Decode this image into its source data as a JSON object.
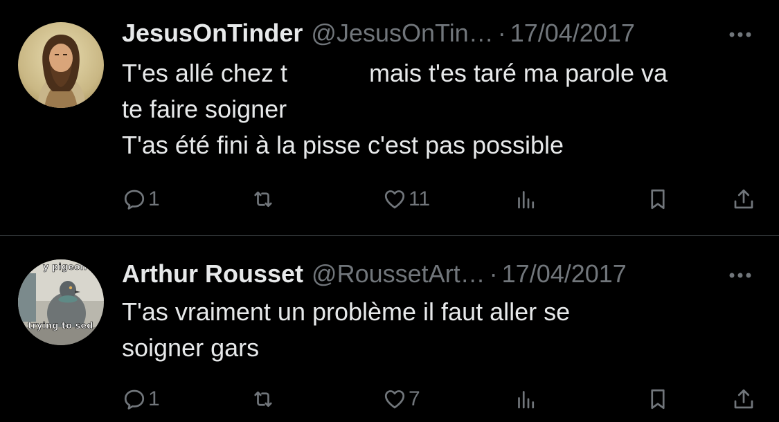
{
  "tweets": [
    {
      "display_name": "JesusOnTinder",
      "handle": "@JesusOnTin…",
      "separator": "·",
      "date": "17/04/2017",
      "avatar_icon": "jesus-portrait-avatar",
      "text": {
        "line1_a": "T'es allé chez t",
        "line1_b": "mais t'es taré ma parole va",
        "line2": "te faire soigner",
        "line3": "T'as été fini à la pisse c'est pas possible"
      },
      "replies": "1",
      "retweets": "",
      "likes": "11"
    },
    {
      "display_name": "Arthur Rousset",
      "handle": "@RoussetArt…",
      "separator": "·",
      "date": "17/04/2017",
      "avatar_icon": "pigeon-meme-avatar",
      "avatar_caption_top": "y pigeon",
      "avatar_caption_bottom": "s trying to sed",
      "text": {
        "line1": "T'as vraiment un problème il faut aller se",
        "line2": "soigner gars"
      },
      "replies": "1",
      "retweets": "",
      "likes": "7"
    }
  ],
  "colors": {
    "background": "#000000",
    "primary_text": "#e7e9ea",
    "secondary_text": "#71767b",
    "divider": "#2f3336"
  },
  "icons": [
    "reply-icon",
    "retweet-icon",
    "like-icon",
    "views-icon",
    "bookmark-icon",
    "share-icon",
    "more-icon"
  ]
}
